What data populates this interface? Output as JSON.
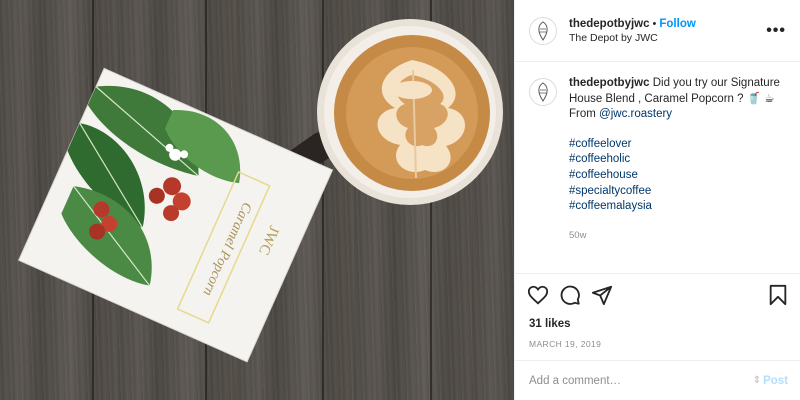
{
  "post": {
    "username": "thedepotbyjwc",
    "follow_label": "Follow",
    "separator": "•",
    "full_name": "The Depot by JWC",
    "more_label": "•••"
  },
  "caption": {
    "username": "thedepotbyjwc",
    "text": "Did you try our Signature House Blend , Caramel Popcorn ? ",
    "from_text": " From ",
    "mention": "@jwc.roastery",
    "hashtags": [
      "#coffeelover",
      "#coffeeholic",
      "#coffeehouse",
      "#specialtycoffee",
      "#coffeemalaysia"
    ],
    "age": "50w"
  },
  "stats": {
    "likes": "31 likes",
    "date": "MARCH 19, 2019"
  },
  "comment_box": {
    "placeholder": "Add a comment…",
    "post_label": "Post"
  },
  "image": {
    "bag_label": "Caramel Popcorn",
    "bag_brand": "JWC"
  },
  "icons": {
    "like": "heart-icon",
    "comment": "comment-icon",
    "share": "paper-plane-icon",
    "save": "bookmark-icon",
    "avatar": "logo-icon"
  },
  "colors": {
    "link": "#0095f6",
    "tag": "#00376b",
    "muted": "#8e8e8e",
    "post_disabled": "#b2dffc"
  }
}
